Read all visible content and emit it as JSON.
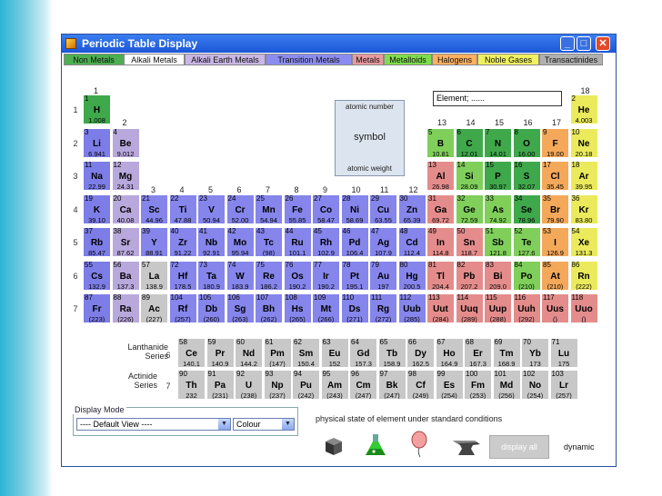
{
  "window": {
    "title": "Periodic Table Display",
    "min": "_",
    "max": "□",
    "close": "✕"
  },
  "tabs": [
    {
      "label": "Non Metals",
      "color": "#4caf50"
    },
    {
      "label": "Alkali Metals",
      "color": "#ffffff"
    },
    {
      "label": "Alkali Earth Metals",
      "color": "#c9b6e4"
    },
    {
      "label": "Transition Metals",
      "color": "#8c8cf0"
    },
    {
      "label": "Metals",
      "color": "#e89aa0"
    },
    {
      "label": "Metalloids",
      "color": "#7fdc4c"
    },
    {
      "label": "Halogens",
      "color": "#ffb060"
    },
    {
      "label": "Noble Gases",
      "color": "#f0f060"
    },
    {
      "label": "Transactinides",
      "color": "#b0b0b0"
    }
  ],
  "group_numbers": [
    "1",
    "2",
    "13",
    "14",
    "15",
    "16",
    "17",
    "18",
    "3",
    "4",
    "5",
    "6",
    "7",
    "8",
    "9",
    "10",
    "11",
    "12"
  ],
  "periods": [
    "1",
    "2",
    "3",
    "4",
    "5",
    "6",
    "7"
  ],
  "lanthanide_label": "Lanthanide Series",
  "actinide_label": "Actinide Series",
  "lanthanide_period": "6",
  "actinide_period": "7",
  "legend": {
    "atomic_number": "atomic number",
    "symbol": "symbol",
    "atomic_weight": "atomic weight"
  },
  "info": "Element; ......",
  "colors": {
    "nonmetal": "#3fa84b",
    "alkali": "#7d7de8",
    "alkaline": "#b9a8dc",
    "transition": "#8585ec",
    "metal": "#e48c8c",
    "metalloid": "#7fcf5a",
    "halogen": "#f4a85a",
    "noble": "#eaea5c",
    "trans": "#b5b5b5",
    "lanthanide": "#c8c8c8"
  },
  "elements": [
    [
      "1",
      "H",
      "1.008",
      "nonmetal",
      1,
      1
    ],
    [
      "2",
      "He",
      "4.003",
      "noble",
      18,
      1
    ],
    [
      "3",
      "Li",
      "6.941",
      "alkali",
      1,
      2
    ],
    [
      "4",
      "Be",
      "9.012",
      "alkaline",
      2,
      2
    ],
    [
      "5",
      "B",
      "10.81",
      "metalloid",
      13,
      2
    ],
    [
      "6",
      "C",
      "12.01",
      "nonmetal",
      14,
      2
    ],
    [
      "7",
      "N",
      "14.01",
      "nonmetal",
      15,
      2
    ],
    [
      "8",
      "O",
      "16.00",
      "nonmetal",
      16,
      2
    ],
    [
      "9",
      "F",
      "19.00",
      "halogen",
      17,
      2
    ],
    [
      "10",
      "Ne",
      "20.18",
      "noble",
      18,
      2
    ],
    [
      "11",
      "Na",
      "22.99",
      "alkali",
      1,
      3
    ],
    [
      "12",
      "Mg",
      "24.31",
      "alkaline",
      2,
      3
    ],
    [
      "13",
      "Al",
      "26.98",
      "metal",
      13,
      3
    ],
    [
      "14",
      "Si",
      "28.09",
      "metalloid",
      14,
      3
    ],
    [
      "15",
      "P",
      "30.97",
      "nonmetal",
      15,
      3
    ],
    [
      "16",
      "S",
      "32.07",
      "nonmetal",
      16,
      3
    ],
    [
      "17",
      "Cl",
      "35.45",
      "halogen",
      17,
      3
    ],
    [
      "18",
      "Ar",
      "39.95",
      "noble",
      18,
      3
    ],
    [
      "19",
      "K",
      "39.10",
      "alkali",
      1,
      4
    ],
    [
      "20",
      "Ca",
      "40.08",
      "alkaline",
      2,
      4
    ],
    [
      "21",
      "Sc",
      "44.96",
      "transition",
      3,
      4
    ],
    [
      "22",
      "Ti",
      "47.88",
      "transition",
      4,
      4
    ],
    [
      "23",
      "V",
      "50.94",
      "transition",
      5,
      4
    ],
    [
      "24",
      "Cr",
      "52.00",
      "transition",
      6,
      4
    ],
    [
      "25",
      "Mn",
      "54.94",
      "transition",
      7,
      4
    ],
    [
      "26",
      "Fe",
      "55.85",
      "transition",
      8,
      4
    ],
    [
      "27",
      "Co",
      "58.47",
      "transition",
      9,
      4
    ],
    [
      "28",
      "Ni",
      "58.69",
      "transition",
      10,
      4
    ],
    [
      "29",
      "Cu",
      "63.55",
      "transition",
      11,
      4
    ],
    [
      "30",
      "Zn",
      "65.39",
      "transition",
      12,
      4
    ],
    [
      "31",
      "Ga",
      "69.72",
      "metal",
      13,
      4
    ],
    [
      "32",
      "Ge",
      "72.59",
      "metalloid",
      14,
      4
    ],
    [
      "33",
      "As",
      "74.92",
      "metalloid",
      15,
      4
    ],
    [
      "34",
      "Se",
      "78.96",
      "nonmetal",
      16,
      4
    ],
    [
      "35",
      "Br",
      "79.90",
      "halogen",
      17,
      4
    ],
    [
      "36",
      "Kr",
      "83.80",
      "noble",
      18,
      4
    ],
    [
      "37",
      "Rb",
      "85.47",
      "alkali",
      1,
      5
    ],
    [
      "38",
      "Sr",
      "87.62",
      "alkaline",
      2,
      5
    ],
    [
      "39",
      "Y",
      "88.91",
      "transition",
      3,
      5
    ],
    [
      "40",
      "Zr",
      "91.22",
      "transition",
      4,
      5
    ],
    [
      "41",
      "Nb",
      "92.91",
      "transition",
      5,
      5
    ],
    [
      "42",
      "Mo",
      "95.94",
      "transition",
      6,
      5
    ],
    [
      "43",
      "Tc",
      "(98)",
      "transition",
      7,
      5
    ],
    [
      "44",
      "Ru",
      "101.1",
      "transition",
      8,
      5
    ],
    [
      "45",
      "Rh",
      "102.9",
      "transition",
      9,
      5
    ],
    [
      "46",
      "Pd",
      "106.4",
      "transition",
      10,
      5
    ],
    [
      "47",
      "Ag",
      "107.9",
      "transition",
      11,
      5
    ],
    [
      "48",
      "Cd",
      "112.4",
      "transition",
      12,
      5
    ],
    [
      "49",
      "In",
      "114.8",
      "metal",
      13,
      5
    ],
    [
      "50",
      "Sn",
      "118.7",
      "metal",
      14,
      5
    ],
    [
      "51",
      "Sb",
      "121.8",
      "metalloid",
      15,
      5
    ],
    [
      "52",
      "Te",
      "127.6",
      "metalloid",
      16,
      5
    ],
    [
      "53",
      "I",
      "126.9",
      "halogen",
      17,
      5
    ],
    [
      "54",
      "Xe",
      "131.3",
      "noble",
      18,
      5
    ],
    [
      "55",
      "Cs",
      "132.9",
      "alkali",
      1,
      6
    ],
    [
      "56",
      "Ba",
      "137.3",
      "alkaline",
      2,
      6
    ],
    [
      "57",
      "La",
      "138.9",
      "lanthanide",
      3,
      6
    ],
    [
      "72",
      "Hf",
      "178.5",
      "transition",
      4,
      6
    ],
    [
      "73",
      "Ta",
      "180.9",
      "transition",
      5,
      6
    ],
    [
      "74",
      "W",
      "183.9",
      "transition",
      6,
      6
    ],
    [
      "75",
      "Re",
      "186.2",
      "transition",
      7,
      6
    ],
    [
      "76",
      "Os",
      "190.2",
      "transition",
      8,
      6
    ],
    [
      "77",
      "Ir",
      "190.2",
      "transition",
      9,
      6
    ],
    [
      "78",
      "Pt",
      "195.1",
      "transition",
      10,
      6
    ],
    [
      "79",
      "Au",
      "197",
      "transition",
      11,
      6
    ],
    [
      "80",
      "Hg",
      "200.5",
      "transition",
      12,
      6
    ],
    [
      "81",
      "Tl",
      "204.4",
      "metal",
      13,
      6
    ],
    [
      "82",
      "Pb",
      "207.2",
      "metal",
      14,
      6
    ],
    [
      "83",
      "Bi",
      "209.0",
      "metal",
      15,
      6
    ],
    [
      "84",
      "Po",
      "(210)",
      "metalloid",
      16,
      6
    ],
    [
      "85",
      "At",
      "(210)",
      "halogen",
      17,
      6
    ],
    [
      "86",
      "Rn",
      "(222)",
      "noble",
      18,
      6
    ],
    [
      "87",
      "Fr",
      "(223)",
      "alkali",
      1,
      7
    ],
    [
      "88",
      "Ra",
      "(226)",
      "alkaline",
      2,
      7
    ],
    [
      "89",
      "Ac",
      "(227)",
      "lanthanide",
      3,
      7
    ],
    [
      "104",
      "Rf",
      "(257)",
      "transition",
      4,
      7
    ],
    [
      "105",
      "Db",
      "(260)",
      "transition",
      5,
      7
    ],
    [
      "106",
      "Sg",
      "(263)",
      "transition",
      6,
      7
    ],
    [
      "107",
      "Bh",
      "(262)",
      "transition",
      7,
      7
    ],
    [
      "108",
      "Hs",
      "(265)",
      "transition",
      8,
      7
    ],
    [
      "109",
      "Mt",
      "(266)",
      "transition",
      9,
      7
    ],
    [
      "110",
      "Ds",
      "(271)",
      "transition",
      10,
      7
    ],
    [
      "111",
      "Rg",
      "(272)",
      "transition",
      11,
      7
    ],
    [
      "112",
      "Uub",
      "(285)",
      "transition",
      12,
      7
    ],
    [
      "113",
      "Uut",
      "(284)",
      "metal",
      13,
      7
    ],
    [
      "114",
      "Uuq",
      "(289)",
      "metal",
      14,
      7
    ],
    [
      "115",
      "Uup",
      "(288)",
      "metal",
      15,
      7
    ],
    [
      "116",
      "Uuh",
      "(292)",
      "metal",
      16,
      7
    ],
    [
      "117",
      "Uus",
      "()",
      "metal",
      17,
      7
    ],
    [
      "118",
      "Uuo",
      "()",
      "metal",
      18,
      7
    ]
  ],
  "lanthanides": [
    [
      "58",
      "Ce",
      "140.1"
    ],
    [
      "59",
      "Pr",
      "140.9"
    ],
    [
      "60",
      "Nd",
      "144.2"
    ],
    [
      "61",
      "Pm",
      "(147)"
    ],
    [
      "62",
      "Sm",
      "150.4"
    ],
    [
      "63",
      "Eu",
      "152"
    ],
    [
      "64",
      "Gd",
      "157.3"
    ],
    [
      "65",
      "Tb",
      "158.9"
    ],
    [
      "66",
      "Dy",
      "162.5"
    ],
    [
      "67",
      "Ho",
      "164.9"
    ],
    [
      "68",
      "Er",
      "167.3"
    ],
    [
      "69",
      "Tm",
      "168.9"
    ],
    [
      "70",
      "Yb",
      "173"
    ],
    [
      "71",
      "Lu",
      "175"
    ]
  ],
  "actinides": [
    [
      "90",
      "Th",
      "232"
    ],
    [
      "91",
      "Pa",
      "(231)"
    ],
    [
      "92",
      "U",
      "(238)"
    ],
    [
      "93",
      "Np",
      "(237)"
    ],
    [
      "94",
      "Pu",
      "(242)"
    ],
    [
      "95",
      "Am",
      "(243)"
    ],
    [
      "96",
      "Cm",
      "(247)"
    ],
    [
      "97",
      "Bk",
      "(247)"
    ],
    [
      "98",
      "Cf",
      "(249)"
    ],
    [
      "99",
      "Es",
      "(254)"
    ],
    [
      "100",
      "Fm",
      "(253)"
    ],
    [
      "101",
      "Md",
      "(256)"
    ],
    [
      "102",
      "No",
      "(254)"
    ],
    [
      "103",
      "Lr",
      "(257)"
    ]
  ],
  "display_mode": {
    "legend": "Display Mode",
    "view": "---- Default View ----",
    "color": "Colour"
  },
  "state_text": "physical state of element under standard conditions",
  "state_icons": [
    "solid-cube-icon",
    "liquid-flask-icon",
    "gas-balloon-icon",
    "anvil-icon"
  ],
  "display_all": "display all",
  "dynamic": "dynamic"
}
